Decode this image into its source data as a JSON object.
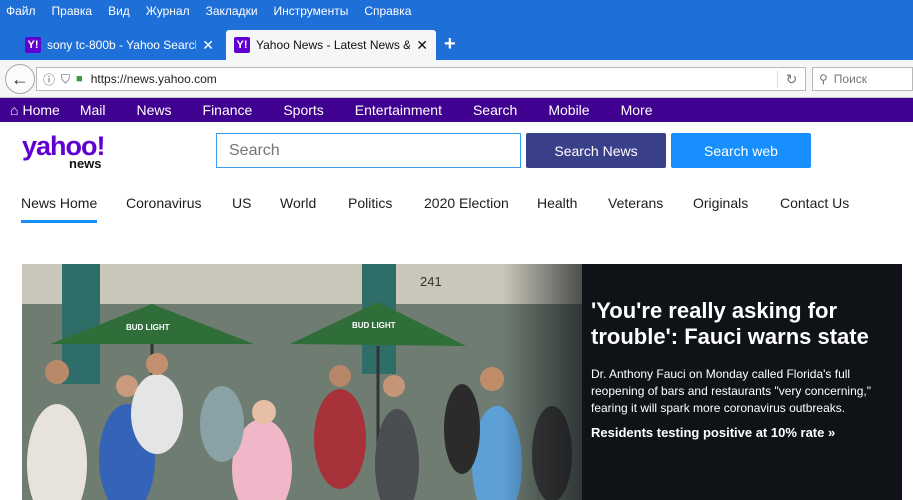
{
  "browser": {
    "menu": [
      "Файл",
      "Правка",
      "Вид",
      "Журнал",
      "Закладки",
      "Инструменты",
      "Справка"
    ],
    "tabs": [
      {
        "favicon": "Y!",
        "title": "sony tc-800b - Yahoo Search ...",
        "active": false
      },
      {
        "favicon": "Y!",
        "title": "Yahoo News - Latest News & ...",
        "active": true
      }
    ],
    "url": "https://news.yahoo.com",
    "search_placeholder": "Поиск"
  },
  "yahoo_nav": {
    "items": [
      "Home",
      "Mail",
      "News",
      "Finance",
      "Sports",
      "Entertainment",
      "Search",
      "Mobile",
      "More"
    ]
  },
  "header": {
    "logo_main": "yahoo!",
    "logo_sub": "news",
    "search_placeholder": "Search",
    "search_news_label": "Search News",
    "search_web_label": "Search web"
  },
  "section_nav": {
    "items": [
      "News Home",
      "Coronavirus",
      "US",
      "World",
      "Politics",
      "2020 Election",
      "Health",
      "Veterans",
      "Originals",
      "Contact Us"
    ],
    "active": "News Home"
  },
  "hero": {
    "headline": "'You're really asking for trouble': Fauci warns state",
    "summary": "Dr. Anthony Fauci on Monday called Florida's full reopening of bars and restaurants \"very concerning,\" fearing it will spark more coronavirus outbreaks.",
    "related": "Residents testing positive at 10% rate »",
    "umbrella_text_1": "BUD LIGHT",
    "umbrella_text_2": "BUD LIGHT",
    "building_number": "241"
  },
  "colors": {
    "chrome_blue": "#1e6fd8",
    "yahoo_purple": "#400090",
    "brand_purple": "#6001d2",
    "search_news_btn": "#3a3f8a",
    "search_web_btn": "#188fff"
  }
}
